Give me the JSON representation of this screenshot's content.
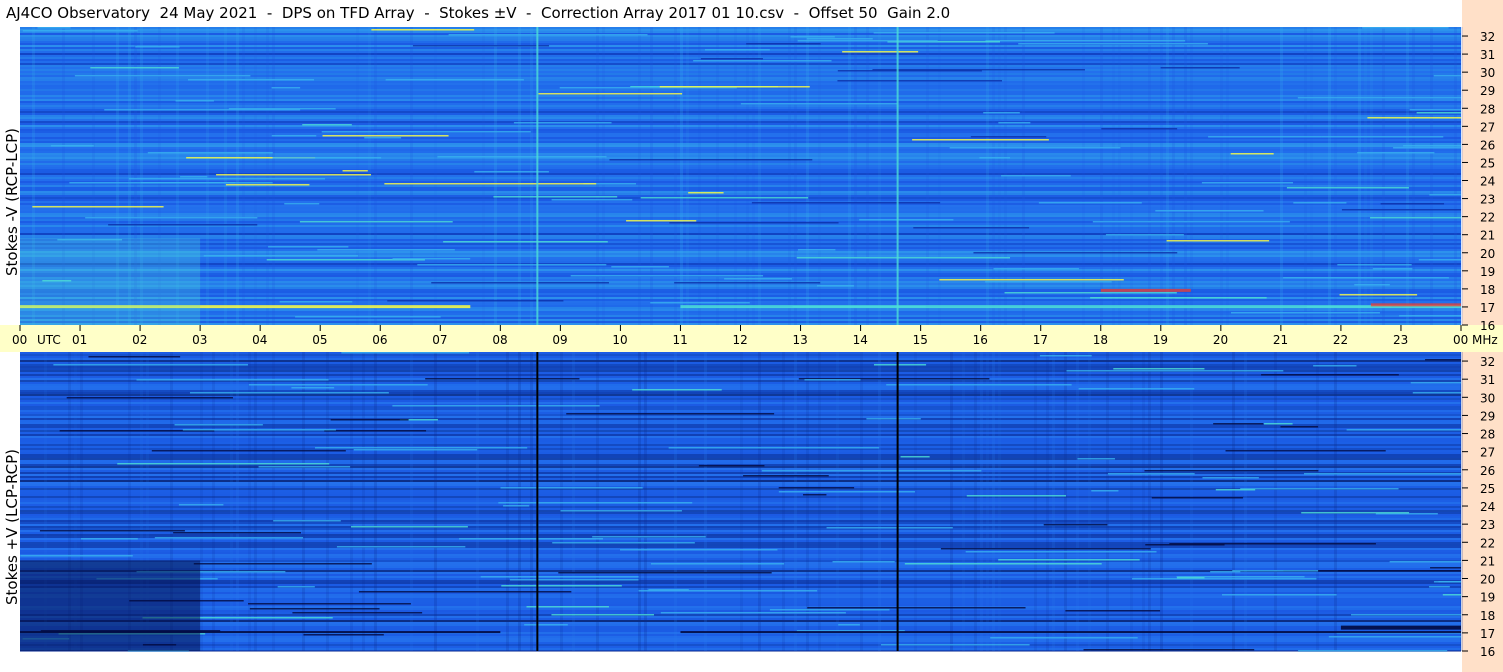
{
  "title": "AJ4CO Observatory  24 May 2021  -  DPS on TFD Array  -  Stokes ±V  -  Correction Array 2017 01 10.csv  -  Offset 50  Gain 2.0",
  "chart_data": [
    {
      "type": "heatmap",
      "panel": "top",
      "ylabel": "Stokes -V (RCP-LCP)",
      "y_unit": "MHz",
      "y_ticks": [
        32,
        31,
        30,
        29,
        28,
        27,
        26,
        25,
        24,
        23,
        22,
        21,
        20,
        19,
        18,
        17,
        16
      ],
      "ylim": [
        16,
        32.5
      ],
      "x_ticks": [
        "00",
        "01",
        "02",
        "03",
        "04",
        "05",
        "06",
        "07",
        "08",
        "09",
        "10",
        "11",
        "12",
        "13",
        "14",
        "15",
        "16",
        "17",
        "18",
        "19",
        "20",
        "21",
        "22",
        "23",
        "00"
      ],
      "xlim_hours": [
        0,
        24
      ],
      "bright_lines_hours": [
        8.6,
        14.6
      ],
      "colormap": [
        "#0b2ea8",
        "#1c55e0",
        "#2a7cf0",
        "#38b2f0",
        "#4ee0d6",
        "#ffff40",
        "#ff3a20"
      ]
    },
    {
      "type": "heatmap",
      "panel": "bottom",
      "ylabel": "Stokes +V (LCP-RCP)",
      "y_unit": "MHz",
      "y_ticks": [
        32,
        31,
        30,
        29,
        28,
        27,
        26,
        25,
        24,
        23,
        22,
        21,
        20,
        19,
        18,
        17,
        16
      ],
      "ylim": [
        16,
        32.5
      ],
      "x_ticks": [
        "00",
        "01",
        "02",
        "03",
        "04",
        "05",
        "06",
        "07",
        "08",
        "09",
        "10",
        "11",
        "12",
        "13",
        "14",
        "15",
        "16",
        "17",
        "18",
        "19",
        "20",
        "21",
        "22",
        "23",
        "00"
      ],
      "xlim_hours": [
        0,
        24
      ],
      "dark_lines_hours": [
        8.6,
        14.6
      ],
      "colormap": [
        "#020a40",
        "#0a2a90",
        "#1c55e0",
        "#2a7cf0",
        "#38b2f0",
        "#4ee0d6"
      ]
    }
  ],
  "time_axis": {
    "utc_label": "UTC",
    "mhz_label": "MHz"
  },
  "colors": {
    "axis_strip": "#ffffc8",
    "side_strip": "#ffe0c8",
    "plot_base": "#1c63e8"
  }
}
